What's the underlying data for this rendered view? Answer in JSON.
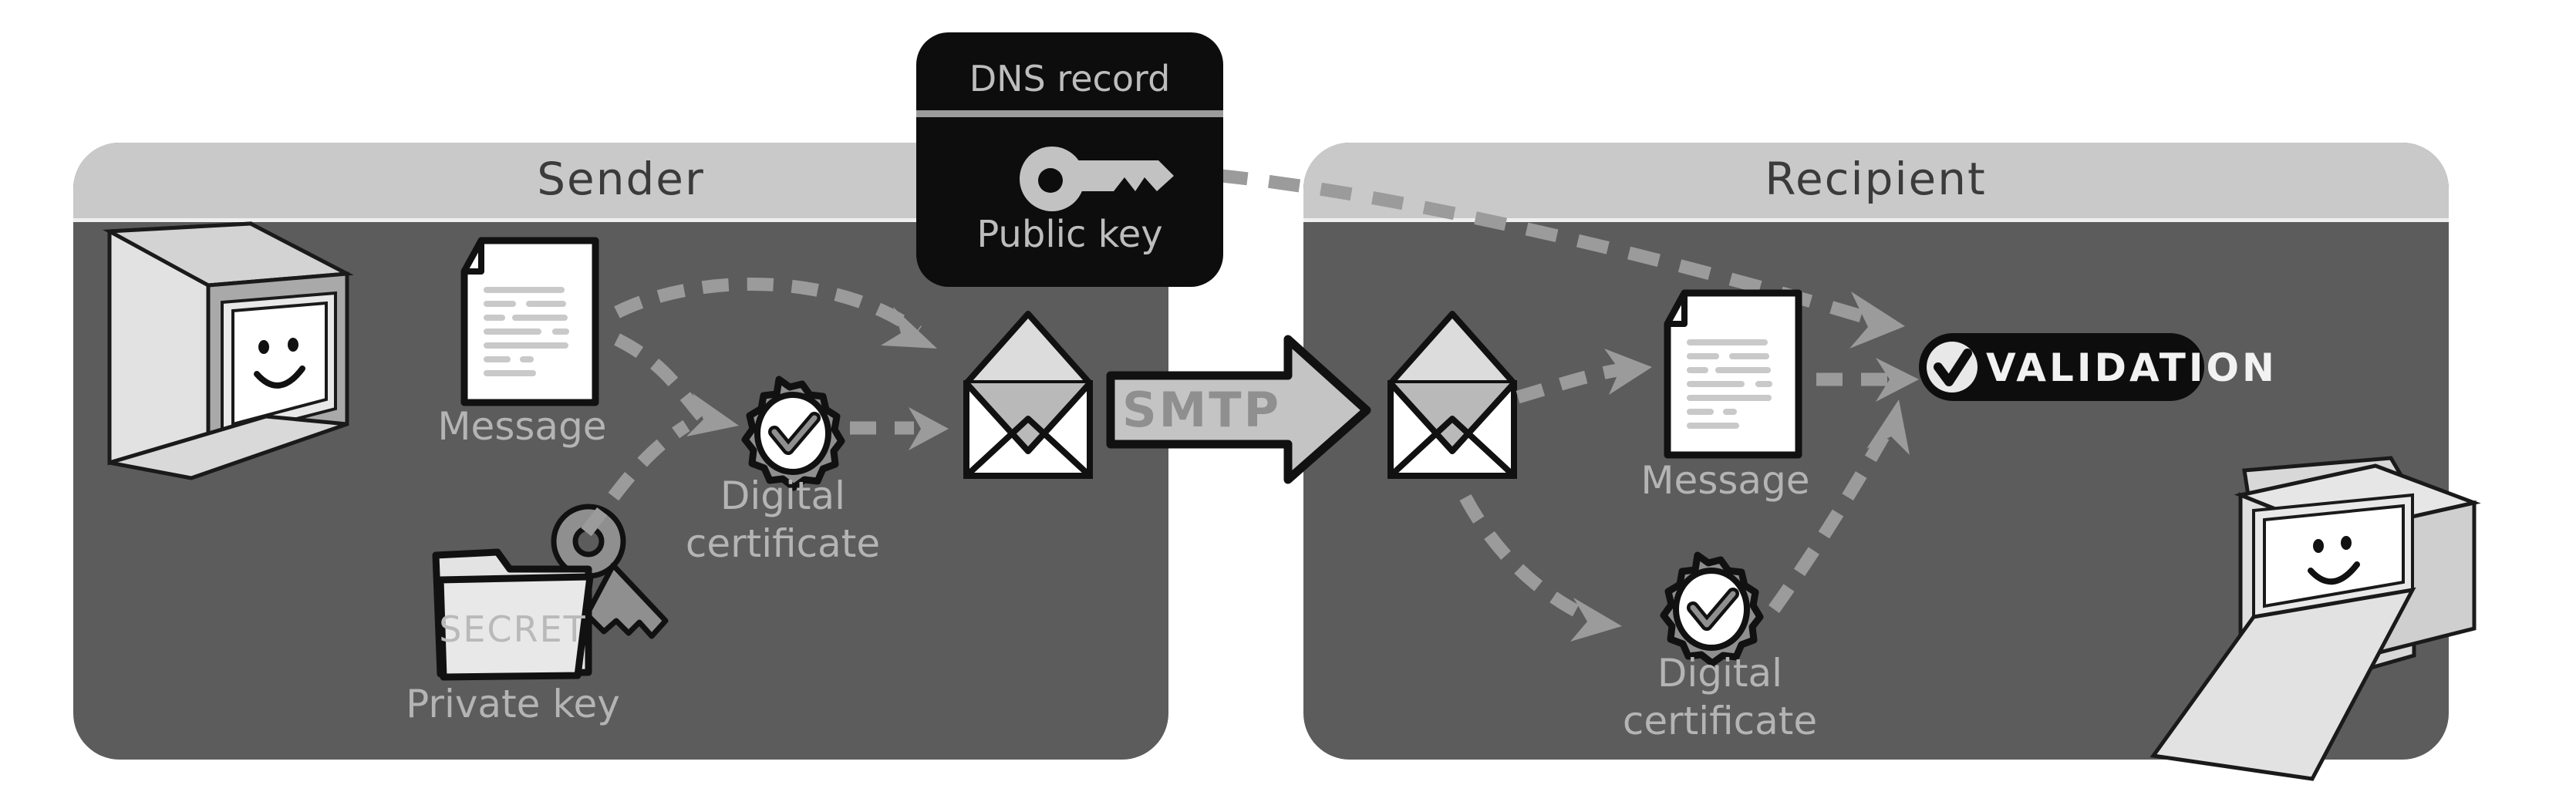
{
  "diagram": {
    "title": "Email signing and validation flow (DKIM / S-MIME style)",
    "background_color": "#ffffff",
    "panel_body_color": "#5c5c5c",
    "panel_header_color": "#c9c9c9",
    "accent_dark": "#0d0d0d",
    "accent_gray": "#9b9b9b",
    "label_color": "#b4b4b4"
  },
  "panels": [
    {
      "id": "sender",
      "header_label": "Sender"
    },
    {
      "id": "recipient",
      "header_label": "Recipient"
    }
  ],
  "dns_card": {
    "title": "DNS record",
    "subtitle": "Public key",
    "icon": "key-icon",
    "background_color": "#0d0d0d",
    "text_color": "#bdbdbd"
  },
  "sender_nodes": {
    "computer": {
      "icon": "computer-smiley-icon",
      "label": ""
    },
    "message": {
      "icon": "document-icon",
      "label": "Message"
    },
    "private_key": {
      "icon": "folder-key-icon",
      "folder_text": "SECRET",
      "label": "Private key"
    },
    "certificate": {
      "icon": "certificate-check-icon",
      "label_line1": "Digital",
      "label_line2": "certificate"
    },
    "envelope": {
      "icon": "envelope-icon",
      "label": ""
    }
  },
  "transport": {
    "label": "SMTP",
    "icon": "right-arrow-icon"
  },
  "recipient_nodes": {
    "envelope": {
      "icon": "envelope-icon",
      "label": ""
    },
    "message": {
      "icon": "document-icon",
      "label": "Message"
    },
    "certificate": {
      "icon": "certificate-check-icon",
      "label_line1": "Digital",
      "label_line2": "certificate"
    },
    "validation": {
      "icon": "check-circle-icon",
      "label": "VALIDATION"
    },
    "computer": {
      "icon": "computer-smiley-icon",
      "label": ""
    }
  },
  "flows": [
    {
      "from": "dns_card",
      "to": "validation",
      "style": "dashed"
    },
    {
      "from": "message",
      "to": "certificate",
      "style": "dashed"
    },
    {
      "from": "private_key",
      "to": "certificate",
      "style": "dashed"
    },
    {
      "from": "message",
      "to": "envelope",
      "style": "dashed"
    },
    {
      "from": "certificate",
      "to": "envelope",
      "style": "dashed"
    },
    {
      "from": "envelope",
      "to": "message",
      "style": "dashed"
    },
    {
      "from": "envelope",
      "to": "certificate",
      "style": "dashed"
    },
    {
      "from": "message",
      "to": "validation",
      "style": "dashed"
    },
    {
      "from": "certificate",
      "to": "validation",
      "style": "dashed"
    }
  ]
}
